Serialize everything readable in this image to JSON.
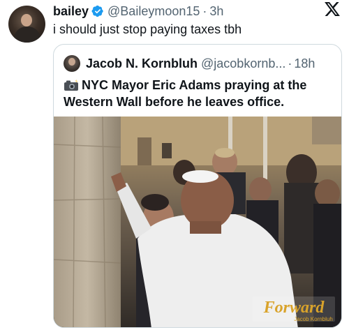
{
  "tweet": {
    "author_name": "bailey",
    "author_handle": "@Baileymoon15",
    "separator": "·",
    "time": "3h",
    "text": "i should just stop paying taxes tbh"
  },
  "quote": {
    "author_name": "Jacob N. Kornbluh",
    "author_handle": "@jacobkornb...",
    "separator": "·",
    "time": "18h",
    "text": "NYC Mayor Eric Adams praying at the Western Wall before he leaves office."
  },
  "photo": {
    "watermark_title": "Forward",
    "watermark_byline": "Jacob Kornbluh"
  },
  "icons": {
    "verified": "verified-badge-icon",
    "platform": "x-logo-icon",
    "camera": "camera-flash-emoji-icon"
  },
  "colors": {
    "text_primary": "#0f1419",
    "text_secondary": "#536471",
    "verified_blue": "#1d9bf0",
    "border": "#cfd9de",
    "watermark_gold": "#d9a32b"
  }
}
